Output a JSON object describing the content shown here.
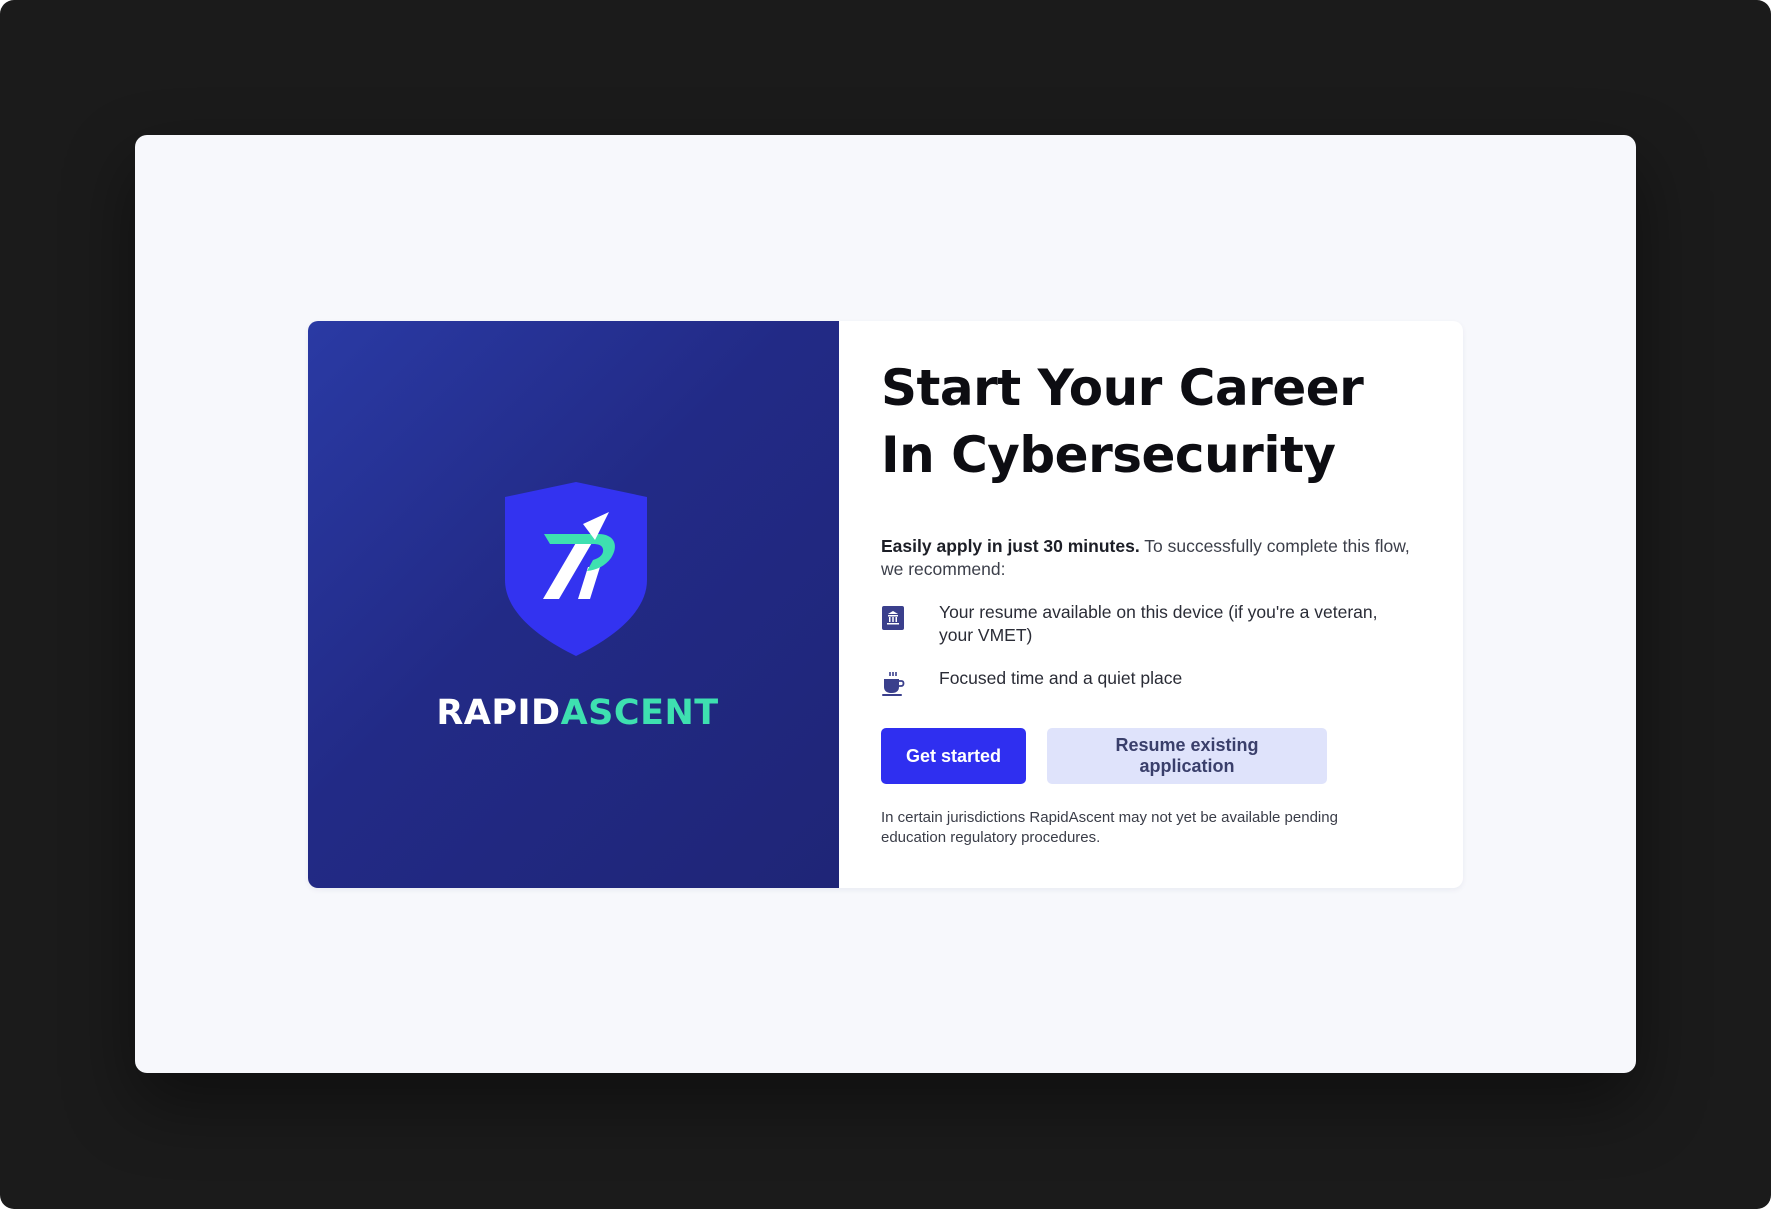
{
  "brand": {
    "name_part1": "RAPID",
    "name_part2": "ASCENT",
    "logo_icon": "shield-logo-icon",
    "colors": {
      "panel": "#222a86",
      "shield": "#3333f0",
      "accent": "#3ee0b0"
    }
  },
  "main": {
    "headline": "Start Your Career In Cybersecurity",
    "intro_bold": "Easily apply in just 30 minutes.",
    "intro_rest": " To successfully complete this flow, we recommend:",
    "recommendations": [
      {
        "icon": "document-icon",
        "text": "Your resume available on this device (if you're a veteran, your VMET)"
      },
      {
        "icon": "coffee-cup-icon",
        "text": "Focused time and a quiet place"
      }
    ],
    "primary_button": "Get started",
    "secondary_button": "Resume existing application",
    "disclaimer": "In certain jurisdictions RapidAscent may not yet be available pending education regulatory procedures."
  },
  "colors": {
    "primary": "#2f2ff0",
    "secondary": "#dfe3fb",
    "background": "#f7f8fc"
  }
}
